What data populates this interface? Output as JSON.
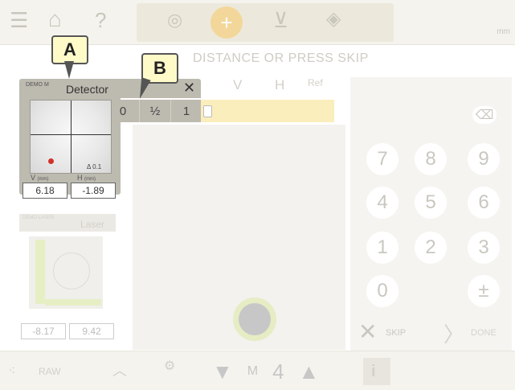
{
  "topbar": {
    "unit": "mm",
    "help": "?"
  },
  "prompt": "DISTANCE OR PRESS SKIP",
  "table": {
    "col_v": "V",
    "col_h": "H",
    "col_ref": "Ref"
  },
  "detector": {
    "mode": "DEMO M",
    "title": "Detector",
    "close": "✕",
    "resolution_options": [
      "0",
      "½",
      "1"
    ],
    "tilt": "Δ 0.1",
    "v_label": "V",
    "h_label": "H",
    "unit_small": "(mm)",
    "v_value": "6.18",
    "h_value": "-1.89"
  },
  "laser": {
    "mode": "DEMO LASER",
    "title": "Laser",
    "x_value": "-8.17",
    "y_value": "9.42"
  },
  "keypad": {
    "keys": [
      "7",
      "8",
      "9",
      "4",
      "5",
      "6",
      "1",
      "2",
      "3",
      "0",
      "",
      "±"
    ],
    "backspace": "⌫",
    "skip": "SKIP",
    "done": "DONE"
  },
  "bottom": {
    "raw": "RAW",
    "count": "4"
  },
  "callouts": {
    "a": "A",
    "b": "B"
  },
  "colors": {
    "panel_grey": "#bdbab0",
    "highlight": "#fbeebd",
    "callout_fill": "#fffbc9",
    "target_dot": "#d2312b"
  }
}
